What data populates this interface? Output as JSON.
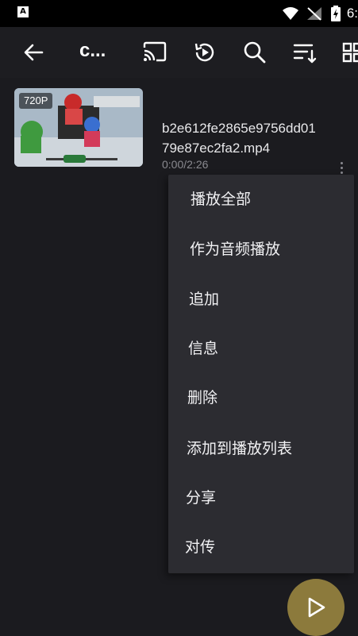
{
  "status_bar": {
    "badge": "A",
    "time": "6:"
  },
  "toolbar": {
    "title": "c..."
  },
  "videos": [
    {
      "filename": "b2e612fe2865e9756dd0179e87ec2fa2.mp4",
      "duration": "0:00/2:26",
      "badge": "720P"
    }
  ],
  "menu": {
    "items": [
      "播放全部",
      "作为音频播放",
      "追加",
      "信息",
      "删除",
      "添加到播放列表",
      "分享",
      "对传"
    ]
  },
  "colors": {
    "background": "#1b1b1f",
    "menu": "#2c2c31",
    "fab": "#8c7a3c"
  }
}
